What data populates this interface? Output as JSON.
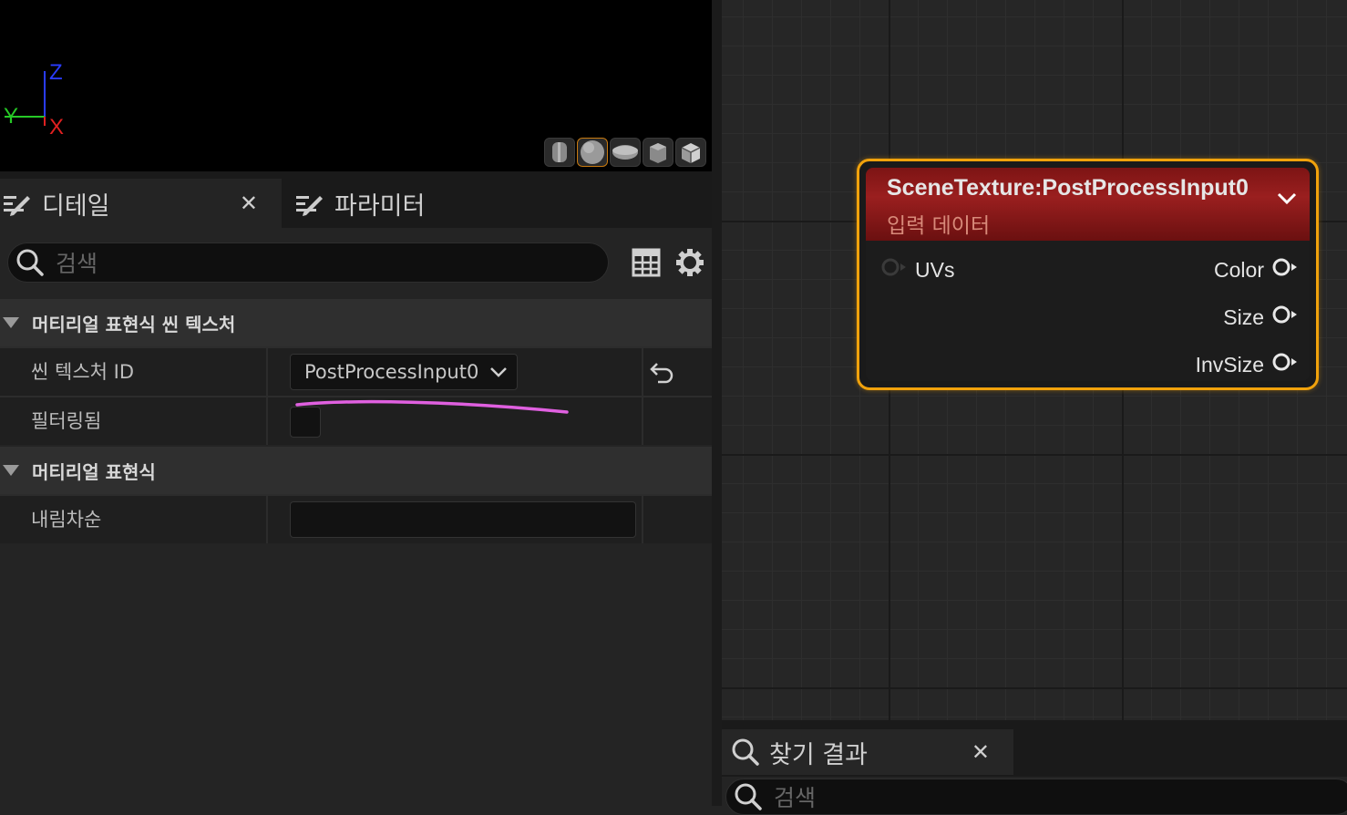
{
  "viewport": {
    "axes": {
      "z": "Z",
      "y": "Y",
      "x": "X"
    },
    "preview_shapes": [
      "cylinder-icon",
      "sphere-icon",
      "plane-icon",
      "cube-icon",
      "teapot-icon"
    ]
  },
  "details": {
    "tabs": [
      {
        "label": "디테일",
        "active": true,
        "closable": true
      },
      {
        "label": "파라미터",
        "active": false
      }
    ],
    "search": {
      "placeholder": "검색"
    },
    "categories": [
      {
        "title": "머티리얼 표현식 씬 텍스처",
        "properties": [
          {
            "name": "씬 텍스처 ID",
            "value": "PostProcessInput0",
            "type": "combo",
            "has_reset": true
          },
          {
            "name": "필터링됨",
            "value": "false",
            "type": "checkbox"
          }
        ]
      },
      {
        "title": "머티리얼 표현식",
        "properties": [
          {
            "name": "내림차순",
            "value": "",
            "type": "text"
          }
        ]
      }
    ]
  },
  "node": {
    "title": "SceneTexture:PostProcessInput0",
    "subtitle": "입력 데이터",
    "inputs": [
      "UVs"
    ],
    "outputs": [
      "Color",
      "Size",
      "InvSize"
    ],
    "header_color": "#8b1a1a",
    "selection_color": "#f1a20c"
  },
  "find_results": {
    "tab_label": "찾기 결과",
    "search_placeholder": "검색"
  },
  "annotation": {
    "color": "#e060e0"
  }
}
